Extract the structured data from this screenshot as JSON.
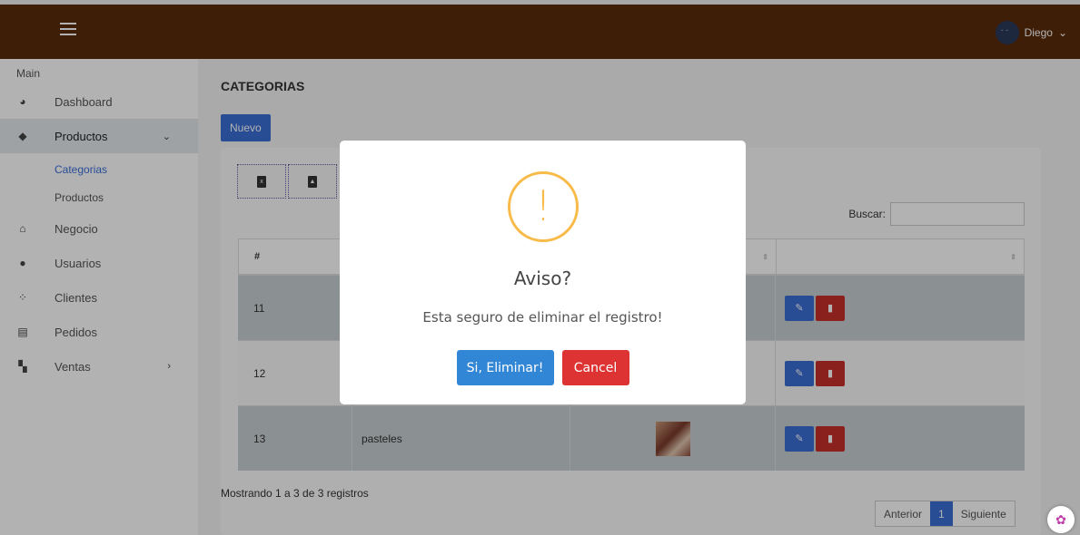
{
  "topbar": {
    "user_name": "Diego",
    "user_caret": "⌄"
  },
  "sidebar": {
    "section": "Main",
    "items": [
      {
        "label": "Dashboard",
        "icon": "pie-chart-icon"
      },
      {
        "label": "Productos",
        "icon": "tags-icon"
      },
      {
        "label": "Negocio",
        "icon": "home-icon"
      },
      {
        "label": "Usuarios",
        "icon": "user-icon"
      },
      {
        "label": "Clientes",
        "icon": "users-icon"
      },
      {
        "label": "Pedidos",
        "icon": "list-icon"
      },
      {
        "label": "Ventas",
        "icon": "cart-icon"
      }
    ],
    "sub_items": [
      {
        "label": "Categorias"
      },
      {
        "label": "Productos"
      }
    ]
  },
  "main": {
    "title": "CATEGORIAS",
    "new_button": "Nuevo",
    "search_label": "Buscar:",
    "search_value": "",
    "table": {
      "headers": [
        "#",
        "",
        "",
        ""
      ],
      "rows": [
        {
          "id": "11",
          "name": ""
        },
        {
          "id": "12",
          "name": ""
        },
        {
          "id": "13",
          "name": "pasteles"
        }
      ]
    },
    "info": "Mostrando 1 a 3 de 3 registros",
    "pager": {
      "prev": "Anterior",
      "current": "1",
      "next": "Siguiente"
    }
  },
  "modal": {
    "icon": "!",
    "title": "Aviso?",
    "text": "Esta seguro de eliminar el registro!",
    "confirm": "Si, Eliminar!",
    "cancel": "Cancel"
  },
  "colors": {
    "topbar": "#5b2c0b",
    "primary": "#3b6fd4",
    "danger": "#c8302a",
    "warning": "#f8bb4a"
  }
}
